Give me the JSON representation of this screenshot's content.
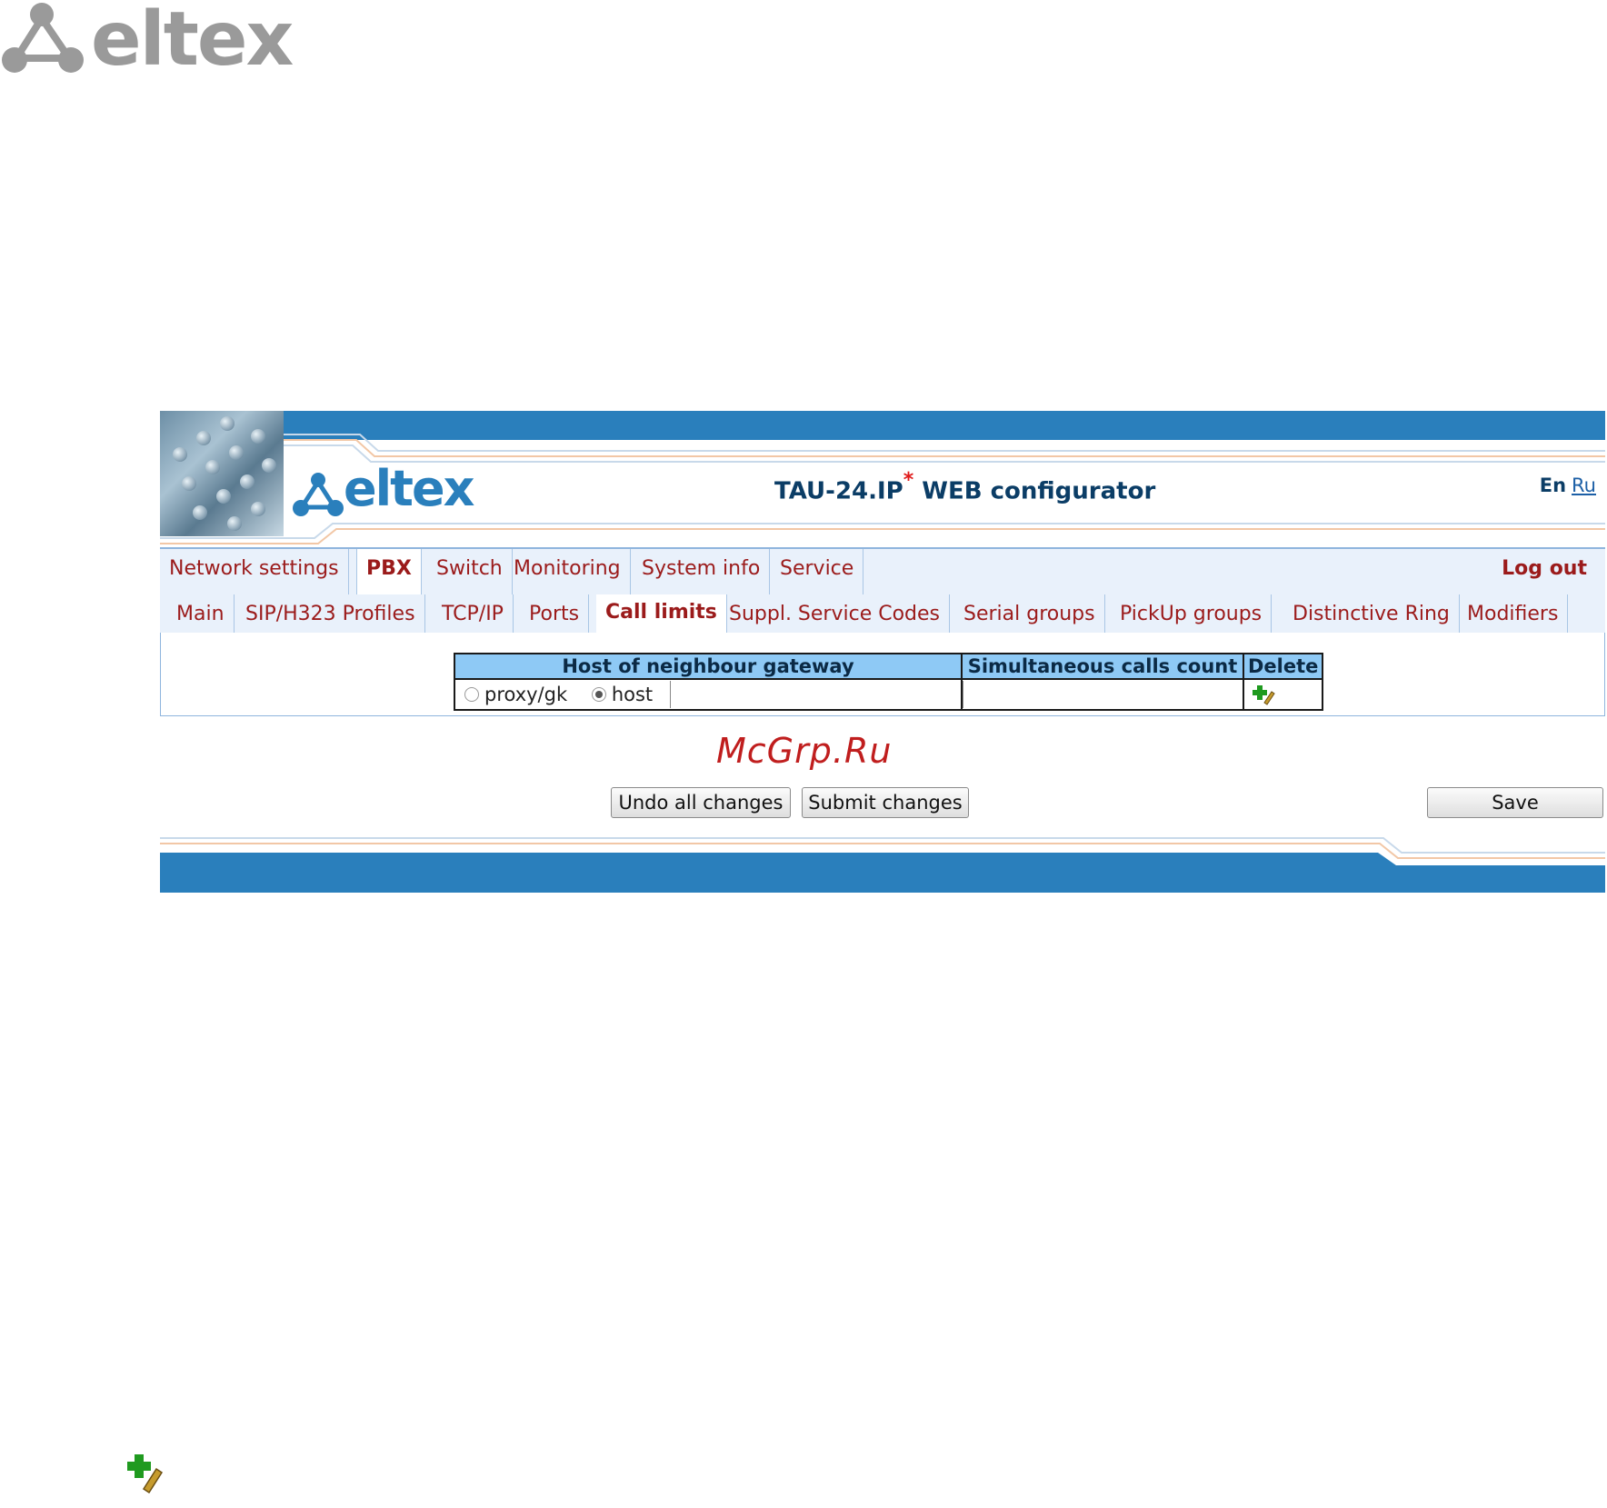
{
  "doc_logo": {
    "text": "eltex"
  },
  "header": {
    "logo_text": "eltex",
    "title_main": "TAU-24.IP",
    "title_mark": "*",
    "title_rest": " WEB configurator",
    "lang_current": "En",
    "lang_other": "Ru"
  },
  "main_menu": {
    "items": [
      {
        "label": "Network settings"
      },
      {
        "label": "PBX"
      },
      {
        "label": "Switch"
      },
      {
        "label": "Monitoring"
      },
      {
        "label": "System info"
      },
      {
        "label": "Service"
      }
    ],
    "active": "PBX",
    "logout": "Log out"
  },
  "sub_menu": {
    "items": [
      {
        "label": "Main"
      },
      {
        "label": "SIP/H323 Profiles"
      },
      {
        "label": "TCP/IP"
      },
      {
        "label": "Ports"
      },
      {
        "label": "Call limits"
      },
      {
        "label": "Suppl. Service Codes"
      },
      {
        "label": "Serial groups"
      },
      {
        "label": "PickUp groups"
      },
      {
        "label": "Distinctive Ring"
      },
      {
        "label": "Modifiers"
      }
    ],
    "active": "Call limits"
  },
  "table": {
    "headers": [
      "Host of neighbour gateway",
      "Simultaneous calls count",
      "Delete"
    ],
    "row": {
      "radio_proxy": "proxy/gk",
      "radio_host": "host",
      "selected": "host",
      "host_value": "",
      "calls_value": ""
    }
  },
  "watermark": "McGrp.Ru",
  "buttons": {
    "undo": "Undo all changes",
    "submit": "Submit changes",
    "save": "Save"
  },
  "colors": {
    "brand_blue": "#2a7fbc",
    "menu_text": "#9b1b1b",
    "header_bg": "#8ec9f5",
    "title_text": "#0b3d66"
  }
}
